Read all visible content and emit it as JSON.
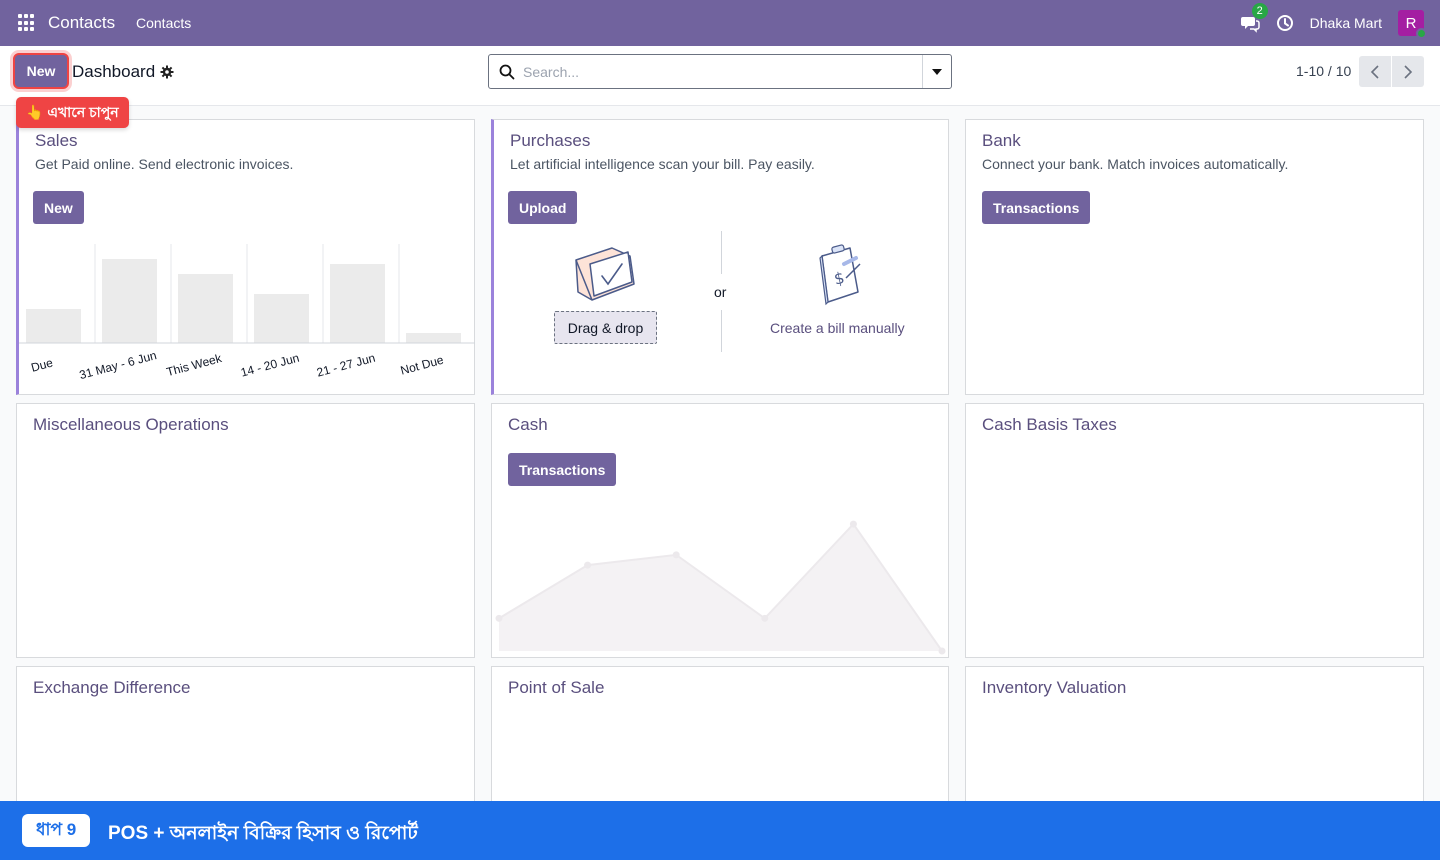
{
  "navbar": {
    "brand": "Contacts",
    "menu_item": "Contacts",
    "chat_count": "2",
    "company": "Dhaka Mart",
    "avatar_initial": "R",
    "color": "#71639e"
  },
  "control": {
    "new_label": "New",
    "title": "Dashboard",
    "search_placeholder": "Search...",
    "pager": "1-10 / 10"
  },
  "tooltip": {
    "text": "👆 এখানে চাপুন"
  },
  "cards": {
    "sales": {
      "title": "Sales",
      "subtitle": "Get Paid online. Send electronic invoices.",
      "button": "New"
    },
    "purchases": {
      "title": "Purchases",
      "subtitle": "Let artificial intelligence scan your bill. Pay easily.",
      "button": "Upload",
      "drag_label": "Drag & drop",
      "or_label": "or",
      "create_label": "Create a bill manually"
    },
    "bank": {
      "title": "Bank",
      "subtitle": "Connect your bank. Match invoices automatically.",
      "button": "Transactions"
    },
    "misc": {
      "title": "Miscellaneous Operations"
    },
    "cash": {
      "title": "Cash",
      "button": "Transactions"
    },
    "cash_basis": {
      "title": "Cash Basis Taxes"
    },
    "exchange": {
      "title": "Exchange Difference"
    },
    "pos": {
      "title": "Point of Sale"
    },
    "inventory": {
      "title": "Inventory Valuation"
    }
  },
  "chart_data": [
    {
      "type": "bar",
      "categories": [
        "Due",
        "31 May - 6 Jun",
        "This Week",
        "14 - 20 Jun",
        "21 - 27 Jun",
        "Not Due"
      ],
      "values": [
        34,
        84,
        69,
        49,
        79,
        10
      ],
      "ylim": [
        0,
        100
      ],
      "color": "#ebebeb"
    },
    {
      "type": "area",
      "x": [
        0,
        1,
        2,
        3,
        4,
        5
      ],
      "values": [
        35,
        92,
        103,
        35,
        136,
        0
      ],
      "ylim": [
        0,
        150
      ],
      "color": "#f4f2f4"
    }
  ],
  "footer": {
    "step": "ধাপ 9",
    "text": "POS + অনলাইন বিক্রির হিসাব ও রিপোর্ট",
    "color": "#1d6fe8"
  }
}
